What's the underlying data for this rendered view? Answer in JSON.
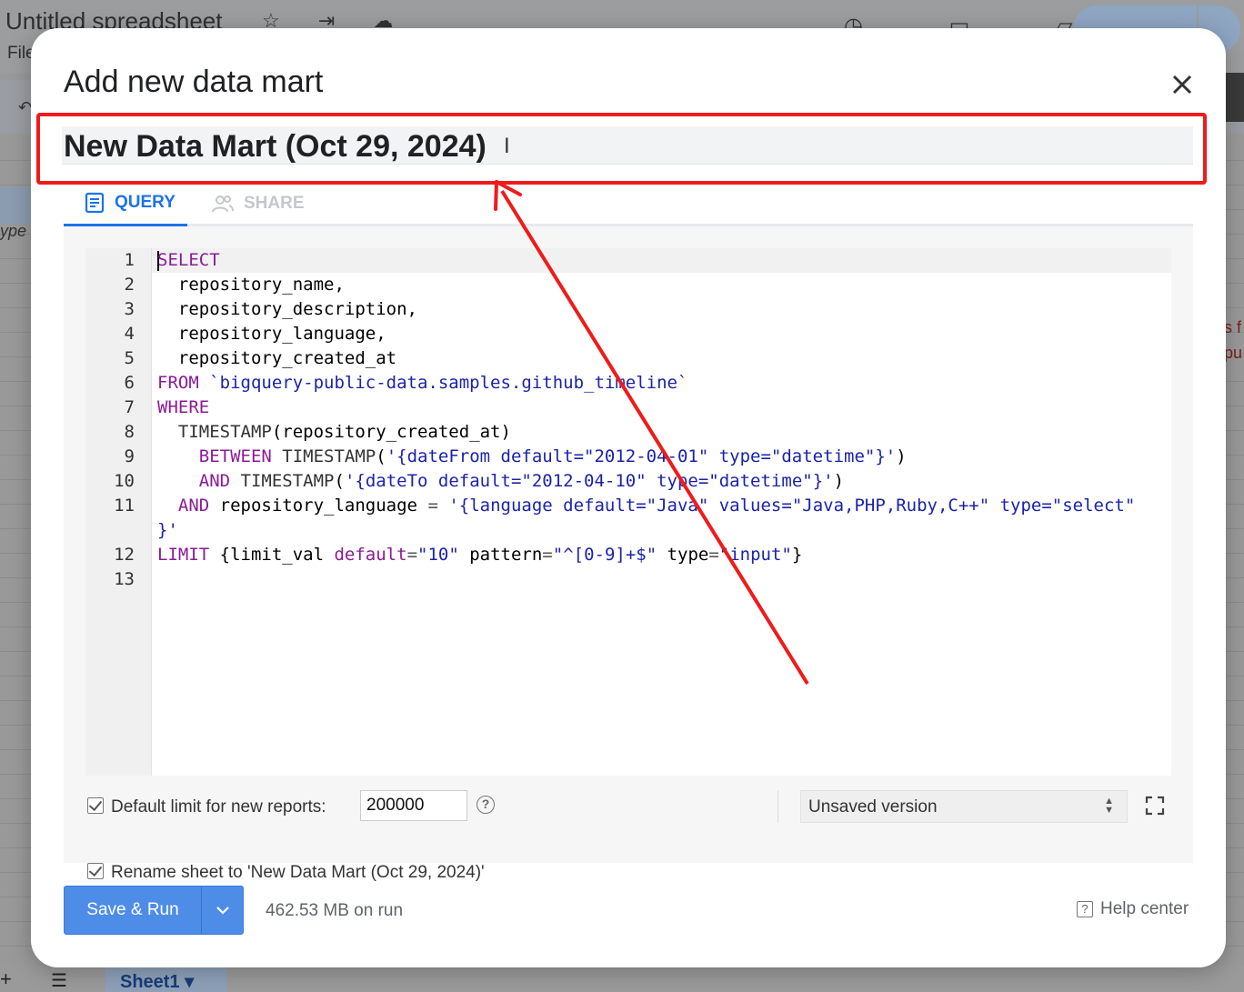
{
  "background": {
    "spreadsheet_title": "Untitled spreadsheet",
    "menu_file": "File",
    "cell_fragment": "ype",
    "side_fragment_1": "s f",
    "side_fragment_2": "pu",
    "sheet_tab": "Sheet1"
  },
  "dialog": {
    "title": "Add new data mart",
    "name_value": "New Data Mart (Oct 29, 2024)",
    "tabs": [
      {
        "label": "QUERY",
        "icon": "document-lines-icon",
        "active": true
      },
      {
        "label": "SHARE",
        "icon": "people-icon",
        "active": false
      }
    ],
    "editor": {
      "line_numbers": [
        "1",
        "2",
        "3",
        "4",
        "5",
        "6",
        "7",
        "8",
        "9",
        "10",
        "11",
        "12",
        "13"
      ]
    },
    "options": {
      "default_limit_label": "Default limit for new reports:",
      "default_limit_value": "200000",
      "default_limit_checked": true,
      "rename_label": "Rename sheet to 'New Data Mart (Oct 29, 2024)'",
      "rename_checked": true,
      "version_select": "Unsaved version"
    },
    "footer": {
      "save_run_label": "Save & Run",
      "cost_text": "462.53 MB on run",
      "help_center_label": "Help center"
    }
  },
  "colors": {
    "accent": "#1a73e8",
    "button": "#4d8de8",
    "annotation": "#ef1b1b",
    "keyword": "#8b1b96",
    "string": "#1b23a8"
  }
}
